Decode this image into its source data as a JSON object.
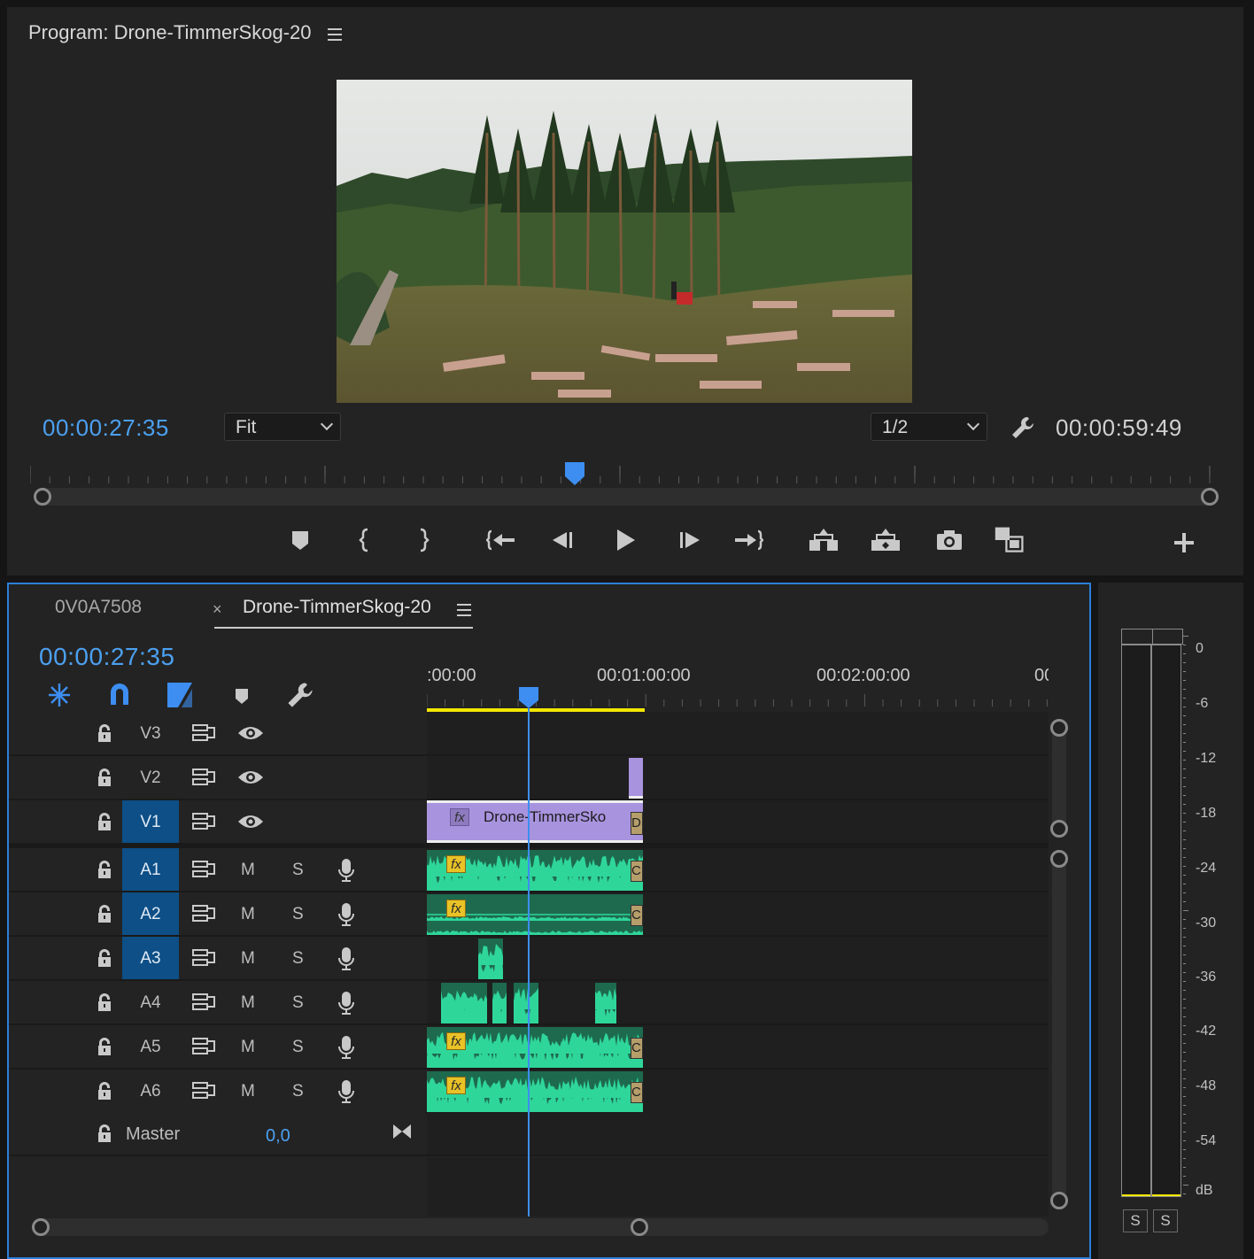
{
  "program": {
    "title": "Program: Drone-TimmerSkog-20",
    "menu_icon": "hamburger-icon",
    "current_timecode": "00:00:27:35",
    "zoom_select": "Fit",
    "resolution_select": "1/2",
    "settings_icon": "wrench-icon",
    "duration_timecode": "00:00:59:49",
    "playhead_fraction": 0.464,
    "transport": [
      {
        "name": "add-marker-button",
        "icon": "marker-icon"
      },
      {
        "name": "mark-in-button",
        "icon": "mark-in-icon"
      },
      {
        "name": "mark-out-button",
        "icon": "mark-out-icon"
      },
      {
        "name": "go-to-in-button",
        "icon": "go-to-in-icon"
      },
      {
        "name": "step-back-button",
        "icon": "step-back-icon"
      },
      {
        "name": "play-button",
        "icon": "play-icon"
      },
      {
        "name": "step-forward-button",
        "icon": "step-forward-icon"
      },
      {
        "name": "go-to-out-button",
        "icon": "go-to-out-icon"
      },
      {
        "name": "lift-button",
        "icon": "lift-icon"
      },
      {
        "name": "extract-button",
        "icon": "extract-icon"
      },
      {
        "name": "export-frame-button",
        "icon": "camera-icon"
      },
      {
        "name": "comparison-view-button",
        "icon": "comparison-icon"
      },
      {
        "name": "button-editor-button",
        "icon": "plus-icon"
      }
    ]
  },
  "timeline": {
    "tabs": [
      {
        "label": "0V0A7508",
        "active": false
      },
      {
        "label": "Drone-TimmerSkog-20",
        "active": true
      }
    ],
    "close_icon": "×",
    "menu_icon": "hamburger-icon",
    "current_timecode": "00:00:27:35",
    "ruler_labels": [
      ":00:00",
      "00:01:00:00",
      "00:02:00:00",
      "00"
    ],
    "tools": [
      {
        "name": "nest-toggle-button",
        "icon": "insert-overwrite-icon"
      },
      {
        "name": "snap-button",
        "icon": "magnet-icon"
      },
      {
        "name": "linked-selection-button",
        "icon": "linked-selection-icon"
      },
      {
        "name": "add-marker-button",
        "icon": "marker-icon"
      },
      {
        "name": "timeline-settings-button",
        "icon": "wrench-icon"
      }
    ],
    "video_tracks": [
      {
        "label": "V3",
        "targeted": false
      },
      {
        "label": "V2",
        "targeted": false
      },
      {
        "label": "V1",
        "targeted": true
      }
    ],
    "audio_tracks": [
      {
        "label": "A1",
        "targeted": true,
        "mute": "M",
        "solo": "S"
      },
      {
        "label": "A2",
        "targeted": true,
        "mute": "M",
        "solo": "S"
      },
      {
        "label": "A3",
        "targeted": true,
        "mute": "M",
        "solo": "S"
      },
      {
        "label": "A4",
        "targeted": false,
        "mute": "M",
        "solo": "S"
      },
      {
        "label": "A5",
        "targeted": false,
        "mute": "M",
        "solo": "S"
      },
      {
        "label": "A6",
        "targeted": false,
        "mute": "M",
        "solo": "S"
      }
    ],
    "master": {
      "label": "Master",
      "value": "0,0"
    },
    "v1_clip_name": "Drone-TimmerSko",
    "fx_badge": "fx",
    "clip_end_label": "D",
    "audio_end_label": "C"
  },
  "meter": {
    "scale": [
      "0",
      "-6",
      "-12",
      "-18",
      "-24",
      "-30",
      "-36",
      "-42",
      "-48",
      "-54",
      "dB"
    ],
    "solo_buttons": [
      "S",
      "S"
    ]
  },
  "colors": {
    "accent_blue": "#4ca0f0",
    "video_clip": "#a893df",
    "audio_clip": "#1e6a4f",
    "waveform": "#2fd69a",
    "work_area": "#f2e600",
    "target_track": "#0d4f86"
  }
}
